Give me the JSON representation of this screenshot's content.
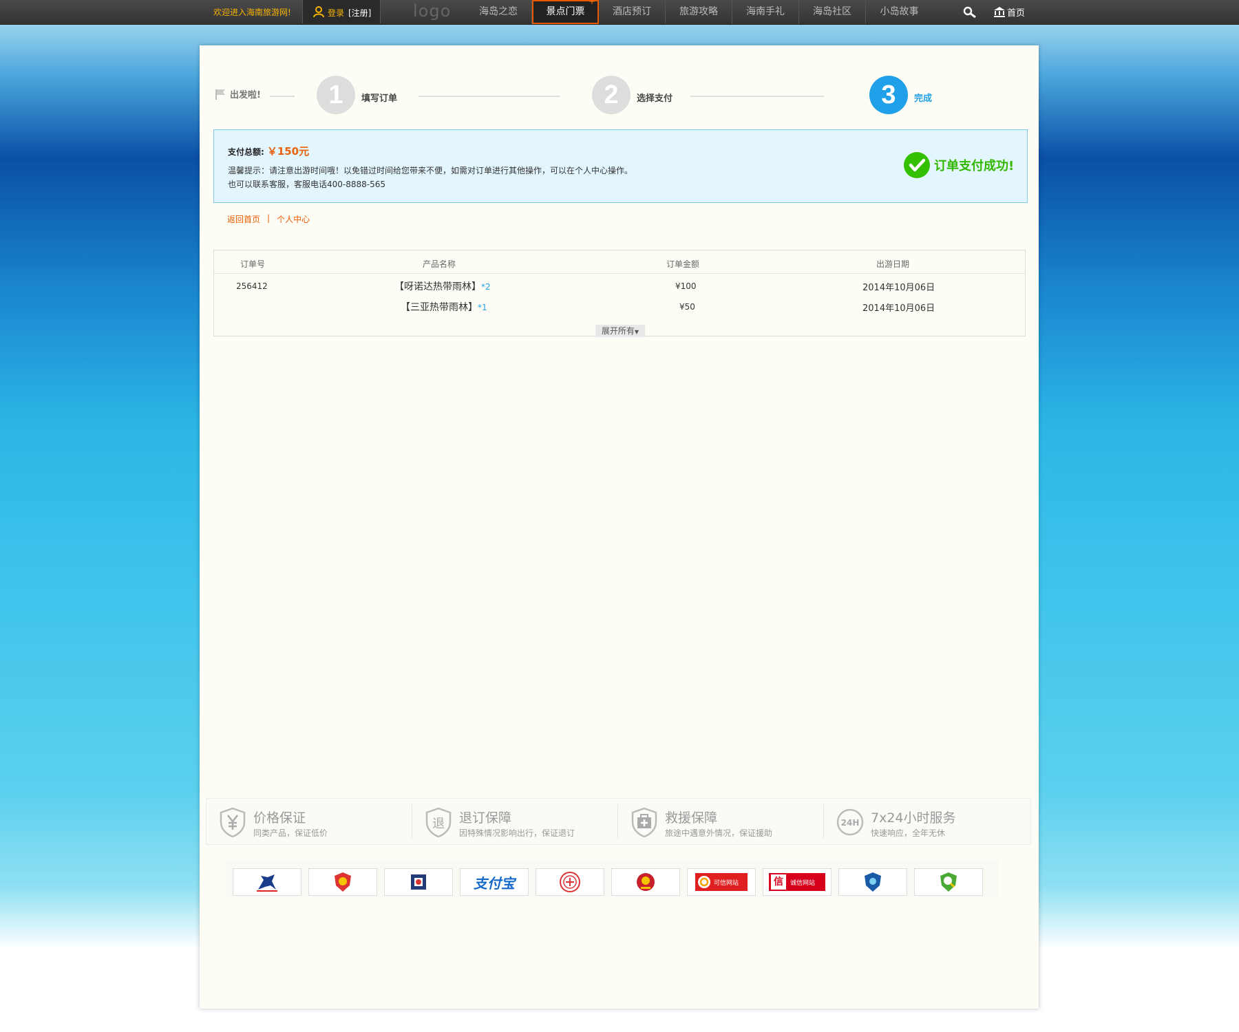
{
  "topbar": {
    "welcome": "欢迎进入海南旅游网!",
    "login": "登录",
    "register": "[注册]",
    "logo": "logo",
    "nav": [
      {
        "label": "海岛之恋",
        "active": false
      },
      {
        "label": "景点门票",
        "active": true,
        "plus": "+"
      },
      {
        "label": "酒店预订",
        "active": false
      },
      {
        "label": "旅游攻略",
        "active": false
      },
      {
        "label": "海南手礼",
        "active": false
      },
      {
        "label": "海岛社区",
        "active": false
      },
      {
        "label": "小岛故事",
        "active": false
      }
    ],
    "home": "首页"
  },
  "steps": {
    "start": "出发啦!",
    "items": [
      {
        "num": "1",
        "label": "填写订单",
        "done": false
      },
      {
        "num": "2",
        "label": "选择支付",
        "done": false
      },
      {
        "num": "3",
        "label": "完成",
        "done": true
      }
    ]
  },
  "payment": {
    "total_label": "支付总额:",
    "total_amount": "￥150元",
    "tip_line1": "温馨提示：请注意出游时间哦！以免错过时间给您带来不便，如需对订单进行其他操作，可以在个人中心操作。",
    "tip_line2": "也可以联系客服，客服电话400-8888-565",
    "success": "订单支付成功!"
  },
  "links": {
    "home": "返回首页",
    "sep": "|",
    "center": "个人中心"
  },
  "orders": {
    "headers": [
      "订单号",
      "产品名称",
      "订单金额",
      "出游日期"
    ],
    "order_id": "256412",
    "rows": [
      {
        "name": "【呀诺达热带雨林】",
        "qty": "*2",
        "amount": "¥100",
        "date": "2014年10月06日"
      },
      {
        "name": "【三亚热带雨林】",
        "qty": "*1",
        "amount": "¥50",
        "date": "2014年10月06日"
      }
    ],
    "expand": "展开所有"
  },
  "guarantees": [
    {
      "icon": "yen-shield-icon",
      "title": "价格保证",
      "sub": "同类产品，保证低价"
    },
    {
      "icon": "refund-shield-icon",
      "title": "退订保障",
      "sub": "因特殊情况影响出行，保证退订"
    },
    {
      "icon": "rescue-shield-icon",
      "title": "救援保障",
      "sub": "旅途中遇意外情况，保证援助"
    },
    {
      "icon": "24h-icon",
      "title": "7x24小时服务",
      "sub": "快速响应，全年无休"
    }
  ],
  "badges": [
    "horse-badge",
    "police-badge",
    "trust-badge",
    "alipay-badge",
    "seal-badge",
    "emblem-badge",
    "kexin-badge",
    "chengxin-badge",
    "shield-badge",
    "search-badge"
  ],
  "badge_texts": {
    "alipay": "支付宝",
    "kexin": "可信网站",
    "chengxin": "诚信网站",
    "xin": "信"
  },
  "colors": {
    "accent": "#e8620b",
    "step_done": "#1fa0e8",
    "success": "#33b800"
  }
}
